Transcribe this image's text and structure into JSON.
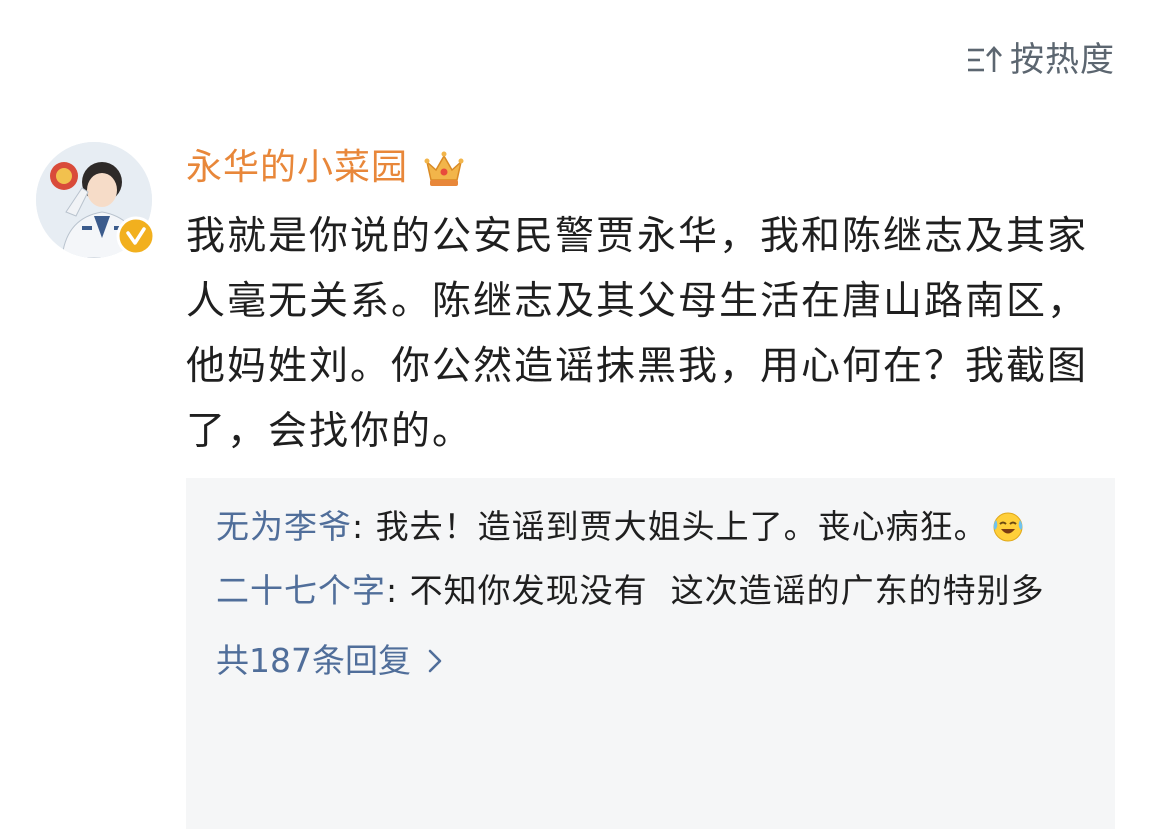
{
  "sort": {
    "label": "按热度",
    "icon": "sort-icon"
  },
  "comment": {
    "username": "永华的小菜园",
    "badge_icon": "crown-icon",
    "verified_icon": "verified-icon",
    "text": "我就是你说的公安民警贾永华，我和陈继志及其家人毫无关系。陈继志及其父母生活在唐山路南区，他妈姓刘。你公然造谣抹黑我，用心何在？我截图了，会找你的。",
    "colors": {
      "username": "#e8873a",
      "text": "#1f1f1f"
    }
  },
  "replies": {
    "items": [
      {
        "author": "无为李爷",
        "separator": ": ",
        "text": "我去！造谣到贾大姐头上了。丧心病狂。",
        "emoji": "laugh-cry-emoji"
      },
      {
        "author": "二十七个字",
        "separator": ": ",
        "text": "不知你发现没有  这次造谣的广东的特别多",
        "emoji": ""
      }
    ],
    "more_label": "共187条回复",
    "colors": {
      "author": "#506e9a",
      "background": "#f5f6f7"
    }
  }
}
